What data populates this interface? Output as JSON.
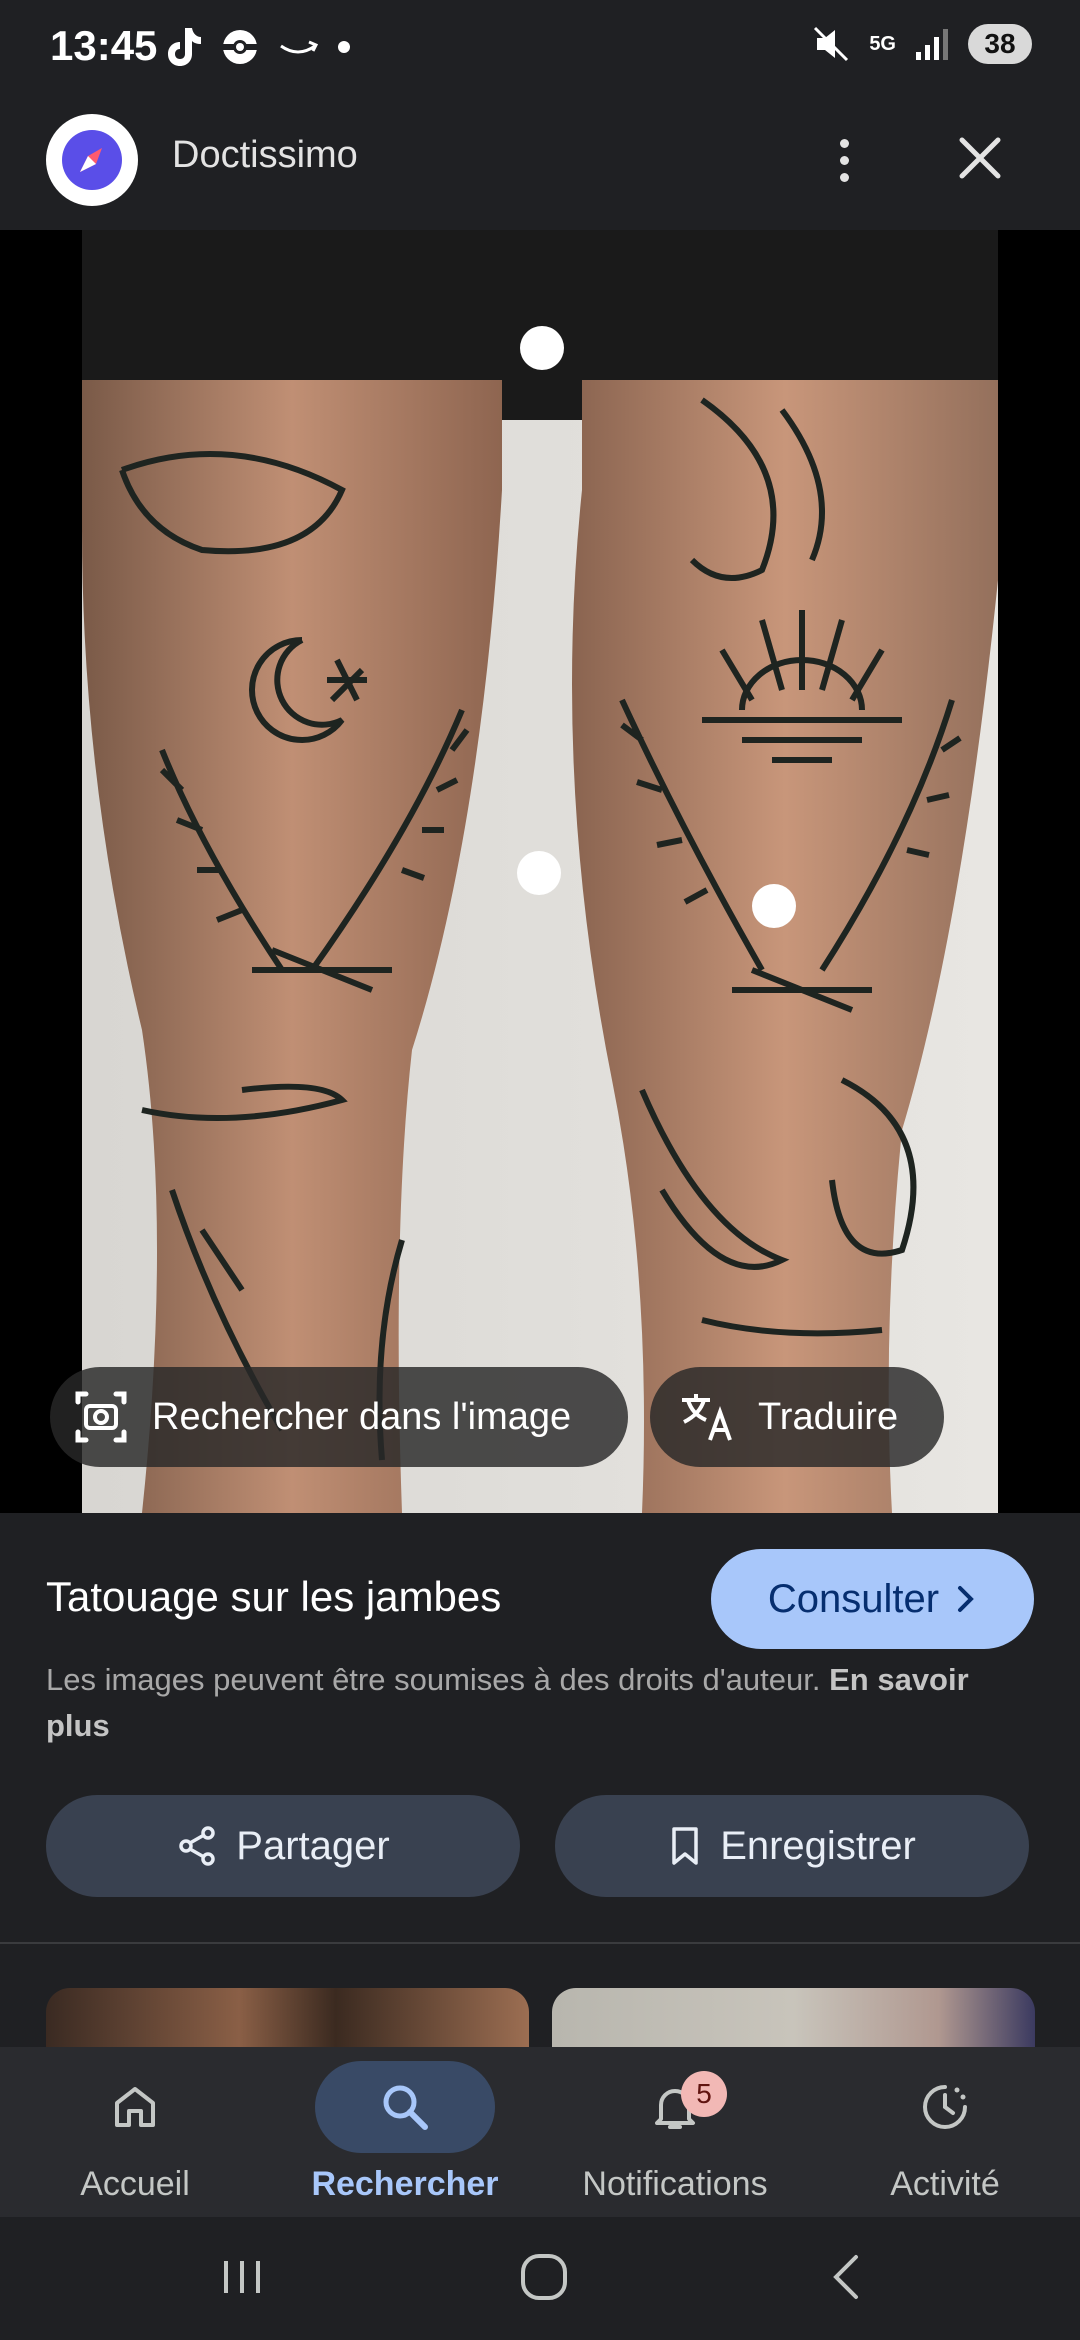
{
  "status_bar": {
    "time": "13:45",
    "network": "5G",
    "battery": "38"
  },
  "header": {
    "site_name": "Doctissimo"
  },
  "image_overlay": {
    "search_in_image": "Rechercher dans l'image",
    "translate": "Traduire"
  },
  "result": {
    "title": "Tatouage sur les jambes",
    "consult_label": "Consulter",
    "copyright_text": "Les images peuvent être soumises à des droits d'auteur.",
    "learn_more": "En savoir plus",
    "share_label": "Partager",
    "save_label": "Enregistrer"
  },
  "bottom_nav": {
    "items": [
      {
        "label": "Accueil",
        "icon": "home-icon"
      },
      {
        "label": "Rechercher",
        "icon": "search-icon",
        "active": true
      },
      {
        "label": "Notifications",
        "icon": "bell-icon",
        "badge": "5"
      },
      {
        "label": "Activité",
        "icon": "activity-icon"
      }
    ]
  },
  "colors": {
    "background": "#1f2023",
    "accent": "#a8c7fa",
    "button": "#394150",
    "badge": "#f2b8b5"
  }
}
